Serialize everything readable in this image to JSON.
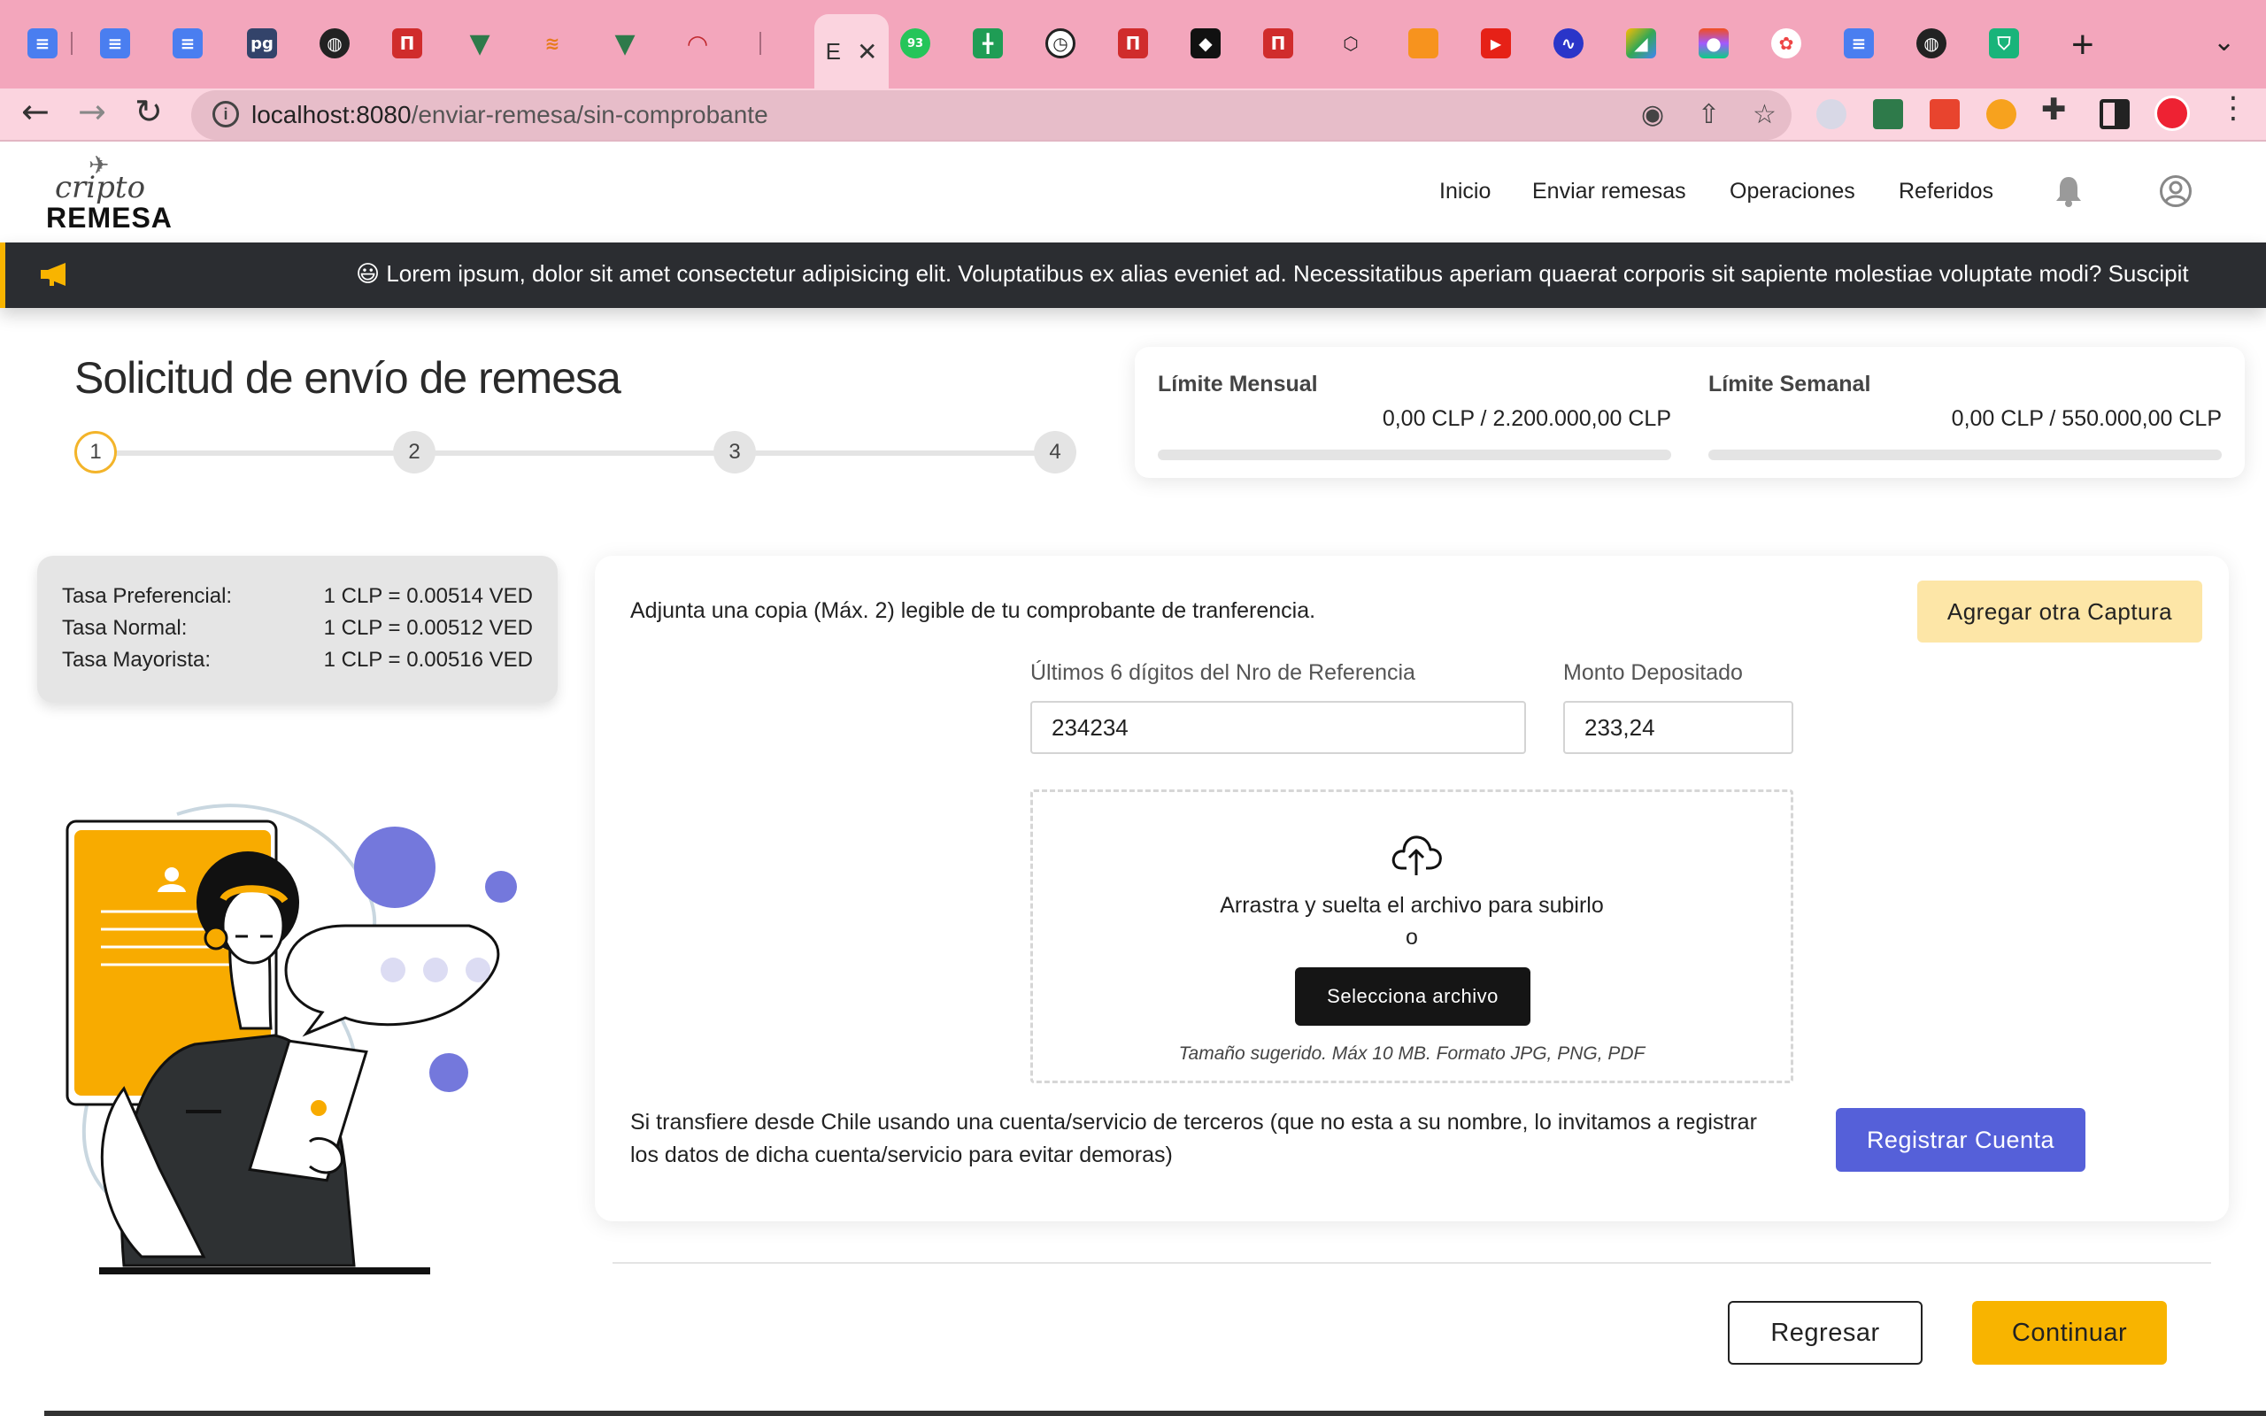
{
  "browser": {
    "active_tab_label": "E",
    "tab_badge": "93",
    "pg_favicon": "pg",
    "url_host": "localhost:8080",
    "url_path": "/enviar-remesa/sin-comprobante",
    "tab_icons": [
      "docs-icon",
      "docs-icon",
      "docs-icon",
      "pg-icon",
      "globe-icon",
      "red-app-icon",
      "vue-icon",
      "stackoverflow-icon",
      "vue-icon",
      "speed-icon",
      "blank",
      "active",
      "whatsapp-icon",
      "sheets-icon",
      "clock-icon",
      "red-app-icon",
      "monkey-icon",
      "red-app-icon",
      "cube-icon",
      "orange-icon",
      "youtube-icon",
      "wave-icon",
      "google-ads-icon",
      "figma-icon",
      "palette-icon",
      "docs-icon",
      "globe-icon",
      "shield-icon"
    ]
  },
  "nav": {
    "logo_top": "cripto",
    "logo_bottom": "REMESA",
    "links": [
      "Inicio",
      "Enviar remesas",
      "Operaciones",
      "Referidos"
    ]
  },
  "ticker": {
    "text": "😃 Lorem ipsum, dolor sit amet consectetur adipisicing elit. Voluptatibus ex alias eveniet ad. Necessitatibus aperiam quaerat corporis sit sapiente molestiae voluptate modi? Suscipit"
  },
  "page": {
    "title": "Solicitud de envío de remesa",
    "steps": [
      "1",
      "2",
      "3",
      "4"
    ],
    "active_step": 1
  },
  "limits": [
    {
      "title": "Límite Mensual",
      "value": "0,00 CLP / 2.200.000,00 CLP",
      "progress": 0
    },
    {
      "title": "Límite Semanal",
      "value": "0,00 CLP / 550.000,00 CLP",
      "progress": 0
    }
  ],
  "rates": [
    {
      "label": "Tasa Preferencial:",
      "value": "1 CLP = 0.00514 VED"
    },
    {
      "label": "Tasa Normal:",
      "value": "1 CLP = 0.00512 VED"
    },
    {
      "label": "Tasa Mayorista:",
      "value": "1 CLP = 0.00516 VED"
    }
  ],
  "form": {
    "intro": "Adjunta una copia (Máx. 2) legible de tu comprobante de tranferencia.",
    "add_capture": "Agregar otra Captura",
    "reference_label": "Últimos 6 dígitos del Nro de Referencia",
    "reference_value": "234234",
    "amount_label": "Monto Depositado",
    "amount_value": "233,24",
    "dropzone_text": "Arrastra y suelta el archivo para subirlo",
    "dropzone_or": "o",
    "select_file": "Selecciona archivo",
    "hint": "Tamaño sugerido. Máx 10 MB. Formato JPG, PNG, PDF",
    "third_party": "Si transfiere desde Chile usando una cuenta/servicio de terceros (que no esta a su nombre, lo invitamos a registrar los datos de dicha cuenta/servicio para evitar demoras)",
    "register_account": "Registrar Cuenta"
  },
  "actions": {
    "back": "Regresar",
    "continue": "Continuar"
  },
  "colors": {
    "accent": "#f8b400",
    "primary": "#5560d9",
    "ticker_bg": "#2b2d31",
    "browser_chrome": "#f3a6bc"
  }
}
